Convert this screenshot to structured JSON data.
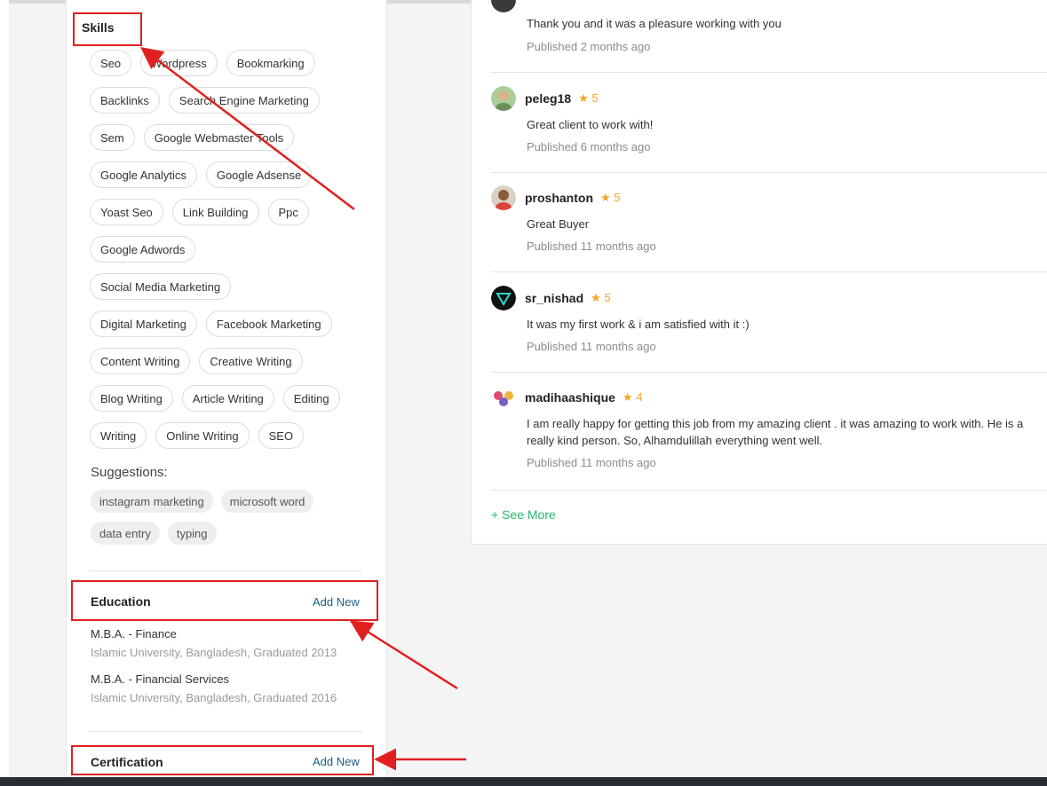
{
  "skills": {
    "title": "Skills",
    "rows": [
      [
        "Seo",
        "Wordpress",
        "Bookmarking"
      ],
      [
        "Backlinks",
        "Search Engine Marketing"
      ],
      [
        "Sem",
        "Google Webmaster Tools"
      ],
      [
        "Google Analytics",
        "Google Adsense"
      ],
      [
        "Yoast Seo",
        "Link Building",
        "Ppc"
      ],
      [
        "Google Adwords"
      ],
      [
        "Social Media Marketing"
      ],
      [
        "Digital Marketing",
        "Facebook Marketing"
      ],
      [
        "Content Writing",
        "Creative Writing"
      ],
      [
        "Blog Writing",
        "Article Writing",
        "Editing"
      ],
      [
        "Writing",
        "Online Writing",
        "SEO"
      ]
    ],
    "suggestions_label": "Suggestions:",
    "suggestions": [
      [
        "instagram marketing",
        "microsoft word"
      ],
      [
        "data entry",
        "typing"
      ]
    ]
  },
  "education": {
    "title": "Education",
    "add_label": "Add New",
    "entries": [
      {
        "degree": "M.B.A. - Finance",
        "meta": "Islamic University, Bangladesh, Graduated 2013"
      },
      {
        "degree": "M.B.A. - Financial Services",
        "meta": "Islamic University, Bangladesh, Graduated 2016"
      }
    ]
  },
  "certification": {
    "title": "Certification",
    "add_label": "Add New"
  },
  "reviews": {
    "items": [
      {
        "name": "",
        "stars": "",
        "rating": null,
        "text": "Thank you and it was a pleasure working with you",
        "date": "Published 2 months ago",
        "avatar_color": "#444444"
      },
      {
        "name": "peleg18",
        "stars": "★ 5",
        "rating": 5,
        "text": "Great client to work with!",
        "date": "Published 6 months ago",
        "avatar_color": "#8bbf7a"
      },
      {
        "name": "proshanton",
        "stars": "★ 5",
        "rating": 5,
        "text": "Great Buyer",
        "date": "Published 11 months ago",
        "avatar_color": "#c95a4a"
      },
      {
        "name": "sr_nishad",
        "stars": "★ 5",
        "rating": 5,
        "text": "It was my first work & i am satisfied with it :)",
        "date": "Published 11 months ago",
        "avatar_color": "#111111"
      },
      {
        "name": "madihaashique",
        "stars": "★ 4",
        "rating": 4,
        "text": "I am really happy for getting this job from my amazing client . it was amazing to work with. He is a really kind person. So, Alhamdulillah everything went well.",
        "date": "Published 11 months ago",
        "avatar_color": "#e04a6a"
      }
    ],
    "see_more": "+ See More"
  },
  "colors": {
    "annotation": "#e02020",
    "star": "#f5a623",
    "link": "#1d5f8a",
    "see_more": "#2bb36e"
  }
}
